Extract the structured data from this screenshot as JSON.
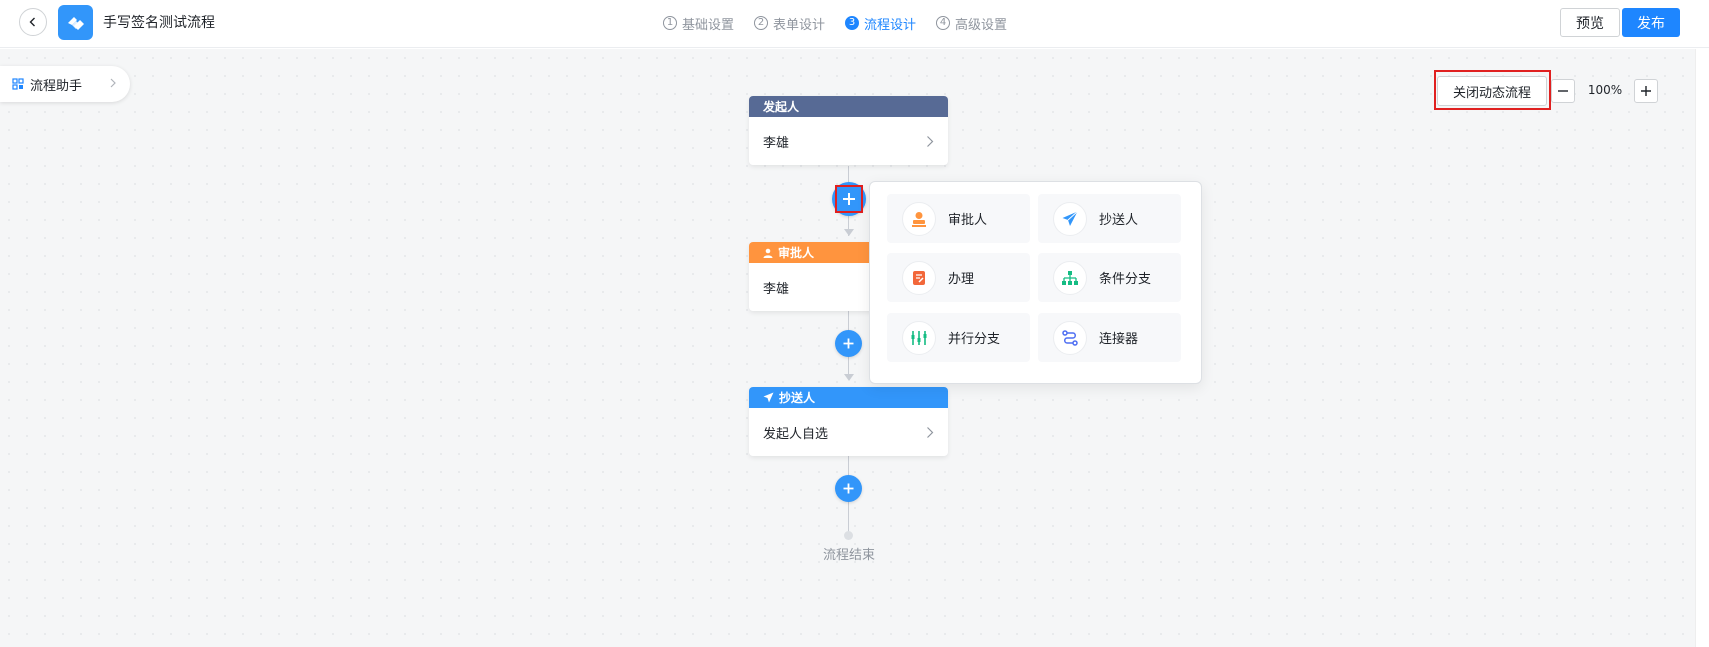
{
  "header": {
    "title": "手写签名测试流程",
    "steps": [
      {
        "num": "1",
        "label": "基础设置",
        "active": false
      },
      {
        "num": "2",
        "label": "表单设计",
        "active": false
      },
      {
        "num": "3",
        "label": "流程设计",
        "active": true
      },
      {
        "num": "4",
        "label": "高级设置",
        "active": false
      }
    ],
    "preview_label": "预览",
    "publish_label": "发布"
  },
  "sidebar": {
    "assistant_label": "流程助手"
  },
  "toolbar": {
    "dynamic_flow_label": "关闭动态流程",
    "zoom_level": "100%"
  },
  "flow": {
    "initiator": {
      "header": "发起人",
      "value": "李雄"
    },
    "approver": {
      "header": "审批人",
      "value": "李雄"
    },
    "cc": {
      "header": "抄送人",
      "value": "发起人自选"
    },
    "end_label": "流程结束"
  },
  "popover": {
    "items": [
      {
        "label": "审批人",
        "icon": "approver-icon"
      },
      {
        "label": "抄送人",
        "icon": "cc-send-icon"
      },
      {
        "label": "办理",
        "icon": "handle-icon"
      },
      {
        "label": "条件分支",
        "icon": "condition-branch-icon"
      },
      {
        "label": "并行分支",
        "icon": "parallel-branch-icon"
      },
      {
        "label": "连接器",
        "icon": "connector-icon"
      }
    ]
  },
  "colors": {
    "primary": "#1e86ff",
    "add_button": "#3296fa",
    "initiator_header": "#576a95",
    "approver_header": "#ff943e",
    "cc_header": "#3296fa",
    "highlight": "#e02020"
  }
}
